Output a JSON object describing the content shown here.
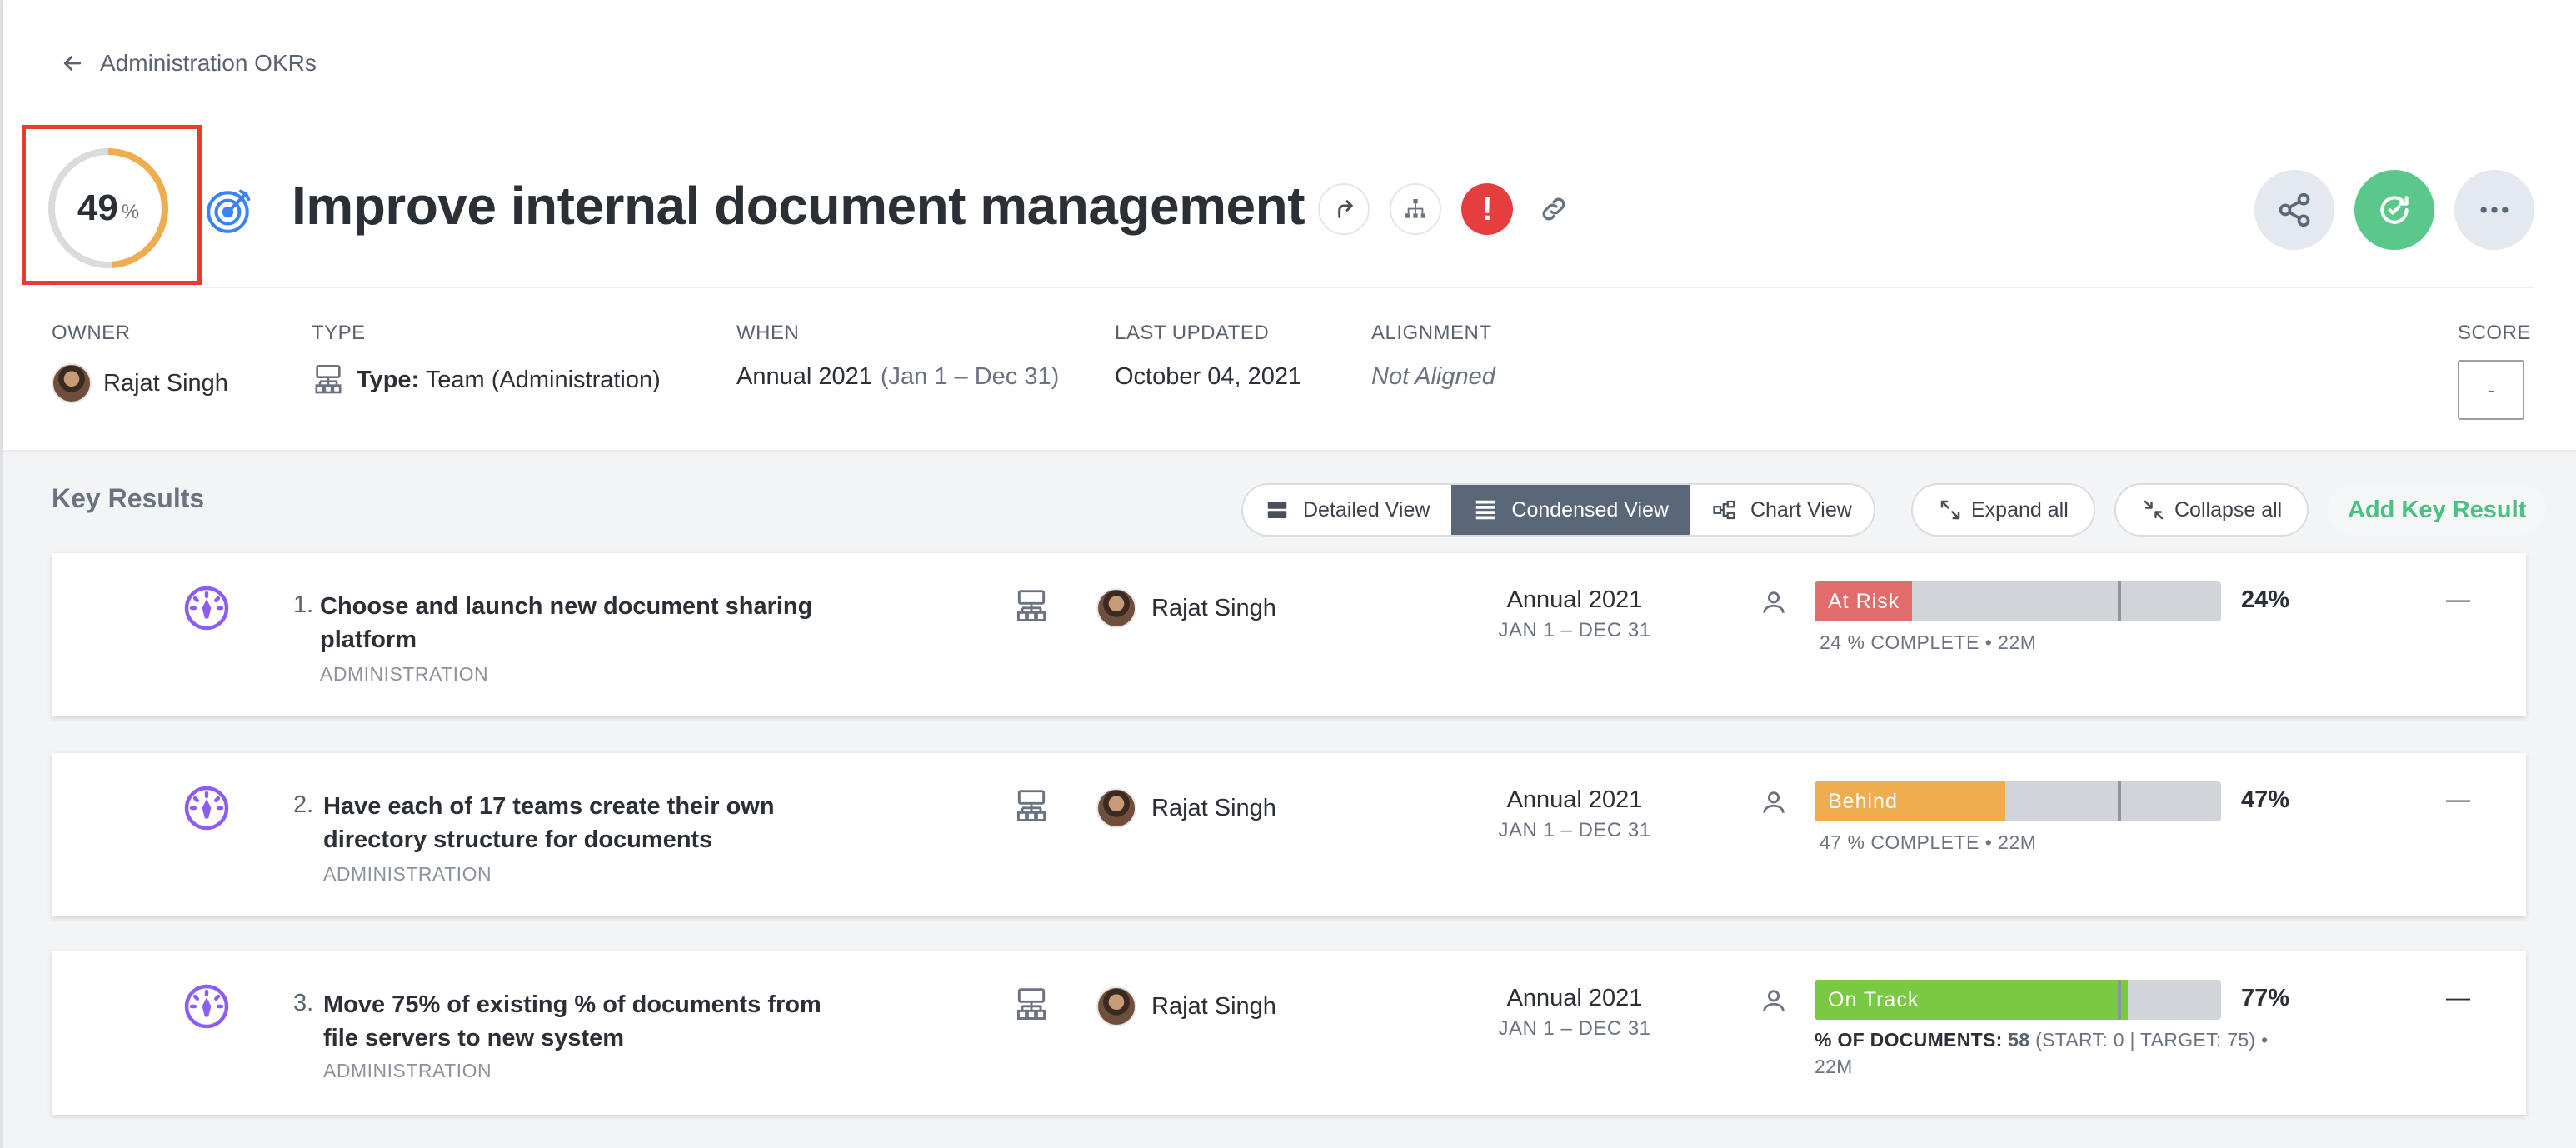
{
  "breadcrumb": {
    "back_label": "Administration OKRs"
  },
  "objective": {
    "progress": 49,
    "progress_number": "49",
    "progress_unit": "%",
    "title": "Improve internal document management",
    "colors": {
      "progress": "#f0ad4e",
      "ring_track": "#d9dbdf",
      "alert": "#e53e3e",
      "update_button": "#5ac88b"
    }
  },
  "meta": {
    "owner": {
      "label": "OWNER",
      "name": "Rajat Singh"
    },
    "type": {
      "label": "TYPE",
      "prefix": "Type:",
      "value": "Team",
      "qualifier": "(Administration)"
    },
    "when": {
      "label": "WHEN",
      "period": "Annual 2021",
      "range": "(Jan 1 – Dec 31)"
    },
    "last_updated": {
      "label": "LAST UPDATED",
      "value": "October 04, 2021"
    },
    "alignment": {
      "label": "ALIGNMENT",
      "value": "Not Aligned"
    },
    "score": {
      "label": "SCORE",
      "value": "-"
    }
  },
  "key_results": {
    "heading": "Key Results",
    "views": {
      "detailed": "Detailed View",
      "condensed": "Condensed View",
      "chart": "Chart View"
    },
    "expand_all": "Expand all",
    "collapse_all": "Collapse all",
    "add": "Add Key Result",
    "items": [
      {
        "num": "1.",
        "name": "Choose and launch new document sharing platform",
        "dept": "ADMINISTRATION",
        "owner": "Rajat Singh",
        "period": "Annual 2021",
        "range": "JAN 1 – DEC 31",
        "status": "At Risk",
        "status_color": "#e06c6c",
        "progress": 24,
        "expected": 75,
        "pct": "24%",
        "sub": "24 % COMPLETE • 22M",
        "score": "—"
      },
      {
        "num": "2.",
        "name": "Have each of 17 teams create their own directory structure for documents",
        "dept": "ADMINISTRATION",
        "owner": "Rajat Singh",
        "period": "Annual 2021",
        "range": "JAN 1 – DEC 31",
        "status": "Behind",
        "status_color": "#f0ad4e",
        "progress": 47,
        "expected": 75,
        "pct": "47%",
        "sub": "47 % COMPLETE • 22M",
        "score": "—"
      },
      {
        "num": "3.",
        "name": "Move 75% of existing % of documents from file servers to new system",
        "dept": "ADMINISTRATION",
        "owner": "Rajat Singh",
        "period": "Annual 2021",
        "range": "JAN 1 – DEC 31",
        "status": "On Track",
        "status_color": "#7ac943",
        "progress": 77,
        "expected": 75,
        "pct": "77%",
        "sub_label": "% OF DOCUMENTS:",
        "sub_value": "58",
        "sub_rest": "(START: 0 | TARGET: 75) • 22M",
        "score": "—"
      }
    ]
  }
}
